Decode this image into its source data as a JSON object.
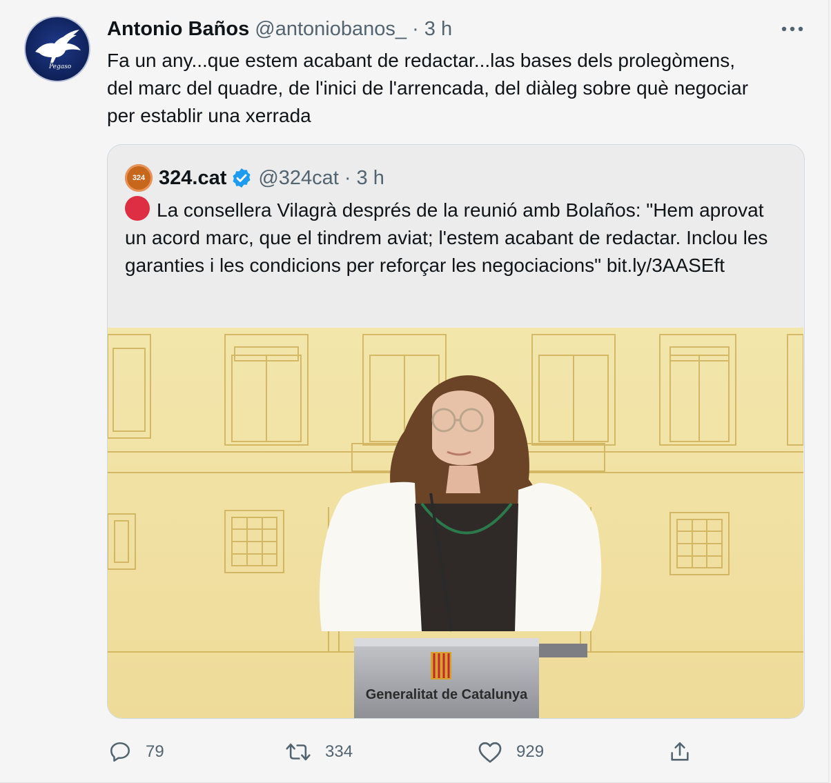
{
  "author": {
    "name": "Antonio Baños",
    "handle": "@antoniobanos_",
    "separator": "·",
    "time": "3 h",
    "avatar_icon": "pegaso-logo",
    "avatar_text": "Pegaso"
  },
  "tweet_text": "Fa un any...que estem acabant de redactar...las bases dels prolegòmens,\ndel marc del quadre, de l'inici de l'arrencada, del diàleg sobre què negociar\nper establir una xerrada",
  "more_icon": "ellipsis-icon",
  "quoted": {
    "avatar_text": "324",
    "name": "324.cat",
    "verified": true,
    "handle": "@324cat",
    "separator": "·",
    "time": "3 h",
    "text": "La consellera Vilagrà després de la reunió amb Bolaños: \"Hem aprovat un acord marc, que el tindrem aviat; l'estem acabant de redactar. Inclou les garanties i les condicions per reforçar les negociacions\" bit.ly/3AASEft",
    "media": {
      "podium_label": "Generalitat de Catalunya"
    }
  },
  "actions": [
    {
      "icon": "reply-icon",
      "count": "79"
    },
    {
      "icon": "retweet-icon",
      "count": "334"
    },
    {
      "icon": "like-icon",
      "count": "929"
    },
    {
      "icon": "share-icon",
      "count": ""
    }
  ],
  "colors": {
    "accent": "#1d9bf0",
    "muted": "#536471",
    "live_red": "#dd2e44",
    "brand_324": "#c7671c"
  }
}
